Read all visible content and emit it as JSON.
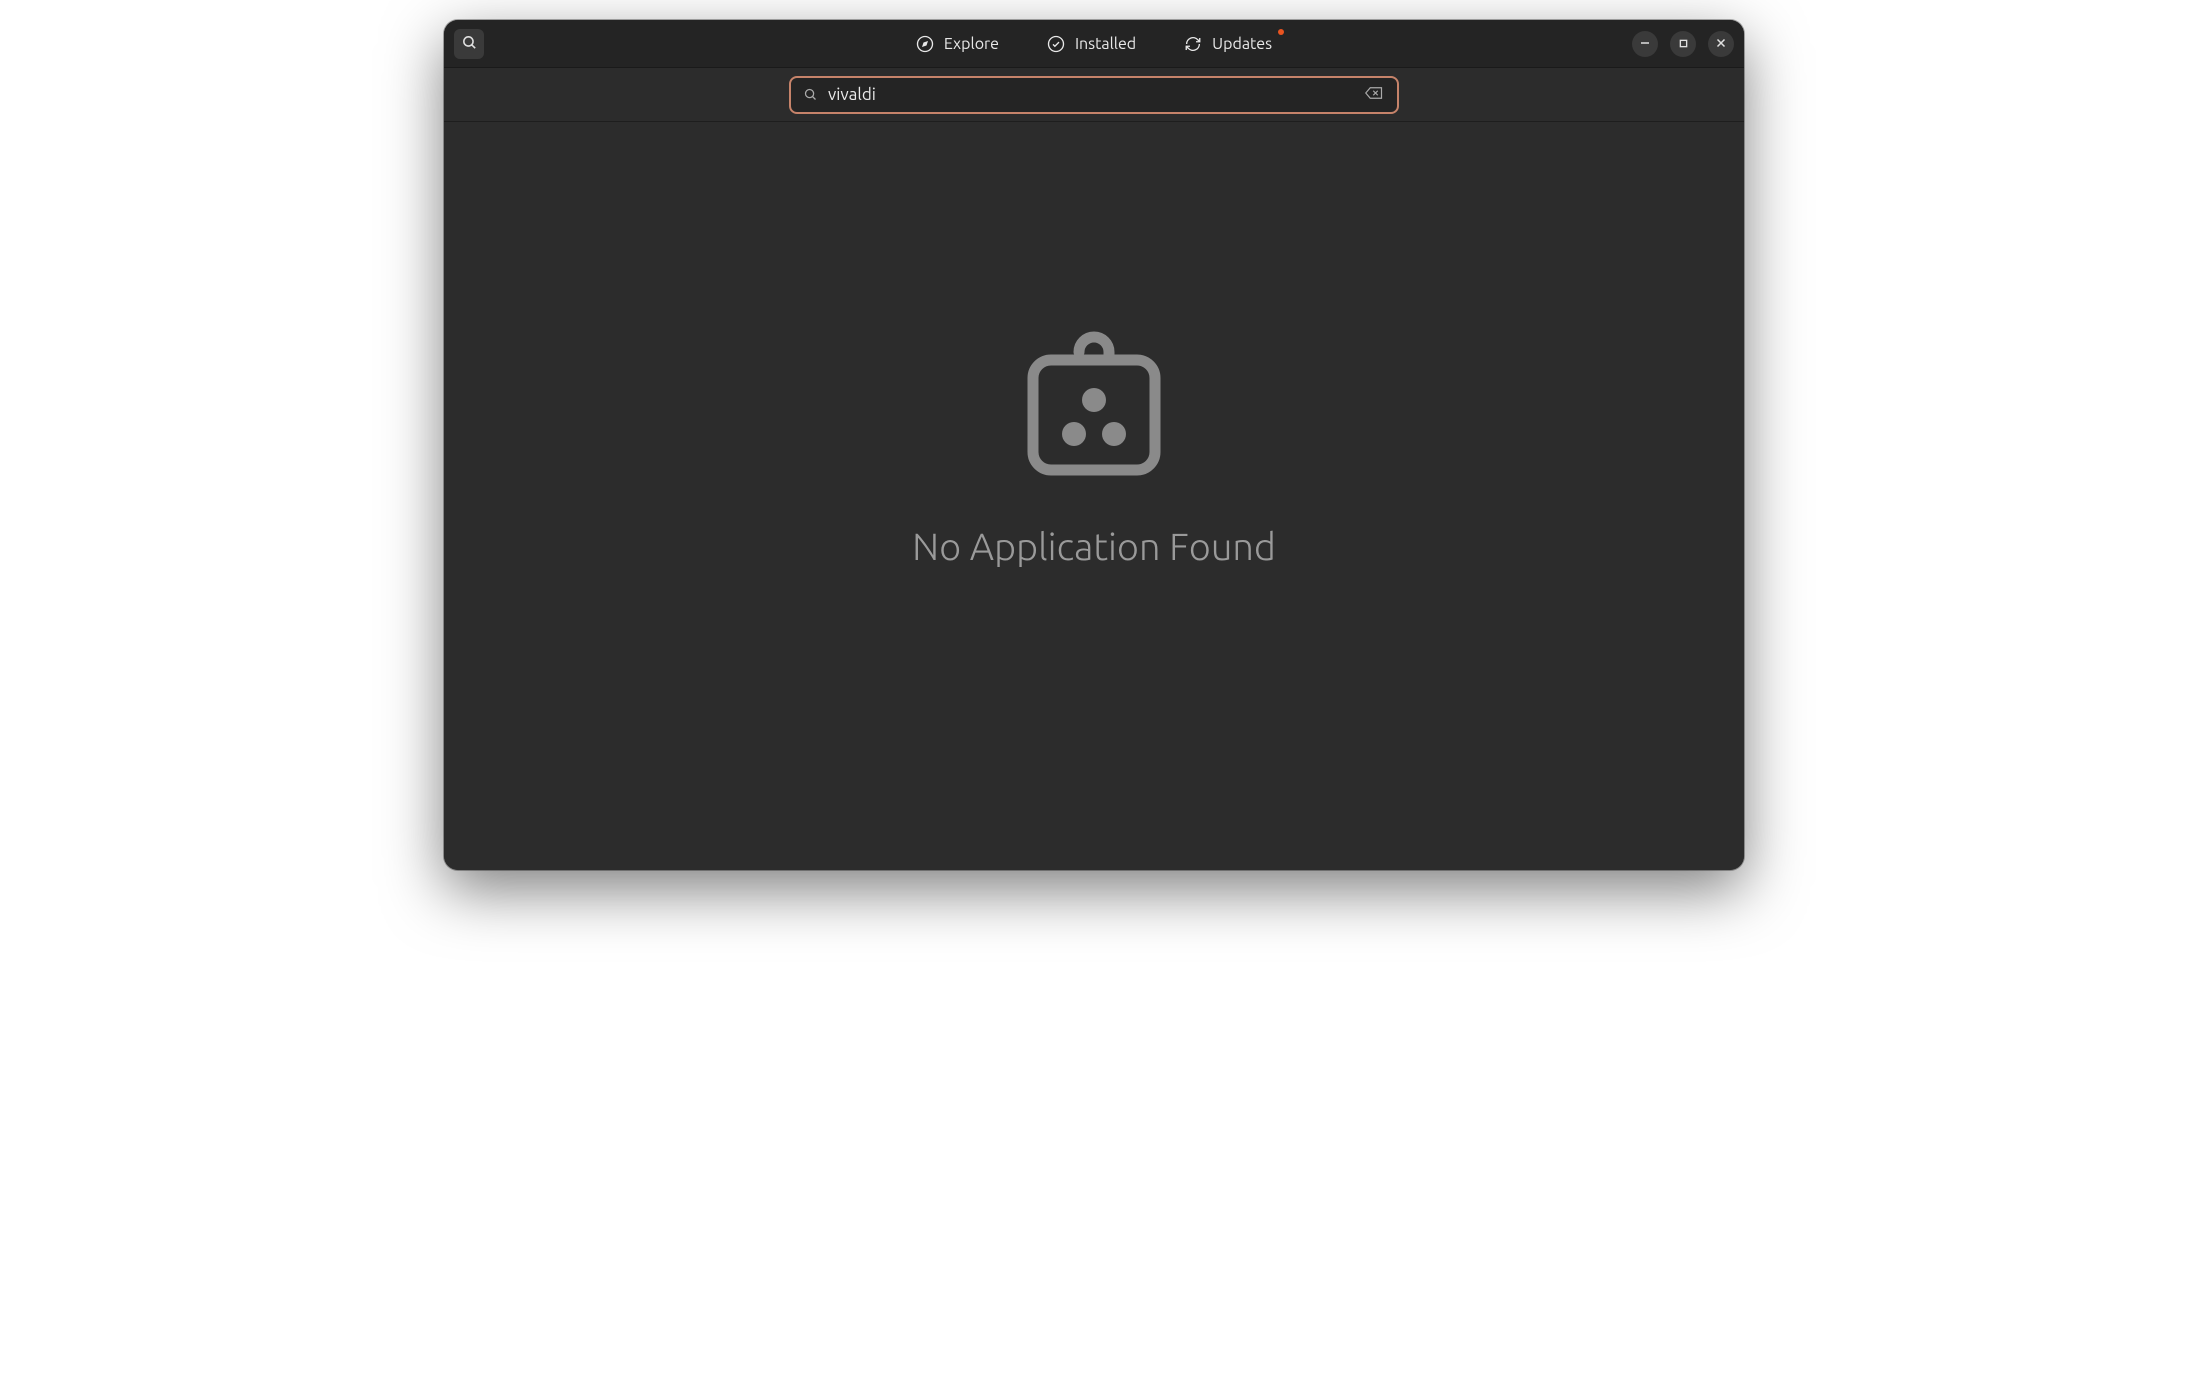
{
  "titlebar": {
    "tabs": {
      "explore": "Explore",
      "installed": "Installed",
      "updates": "Updates"
    },
    "updates_available": true
  },
  "search": {
    "value": "vivaldi",
    "placeholder": ""
  },
  "content": {
    "empty_message": "No Application Found"
  }
}
